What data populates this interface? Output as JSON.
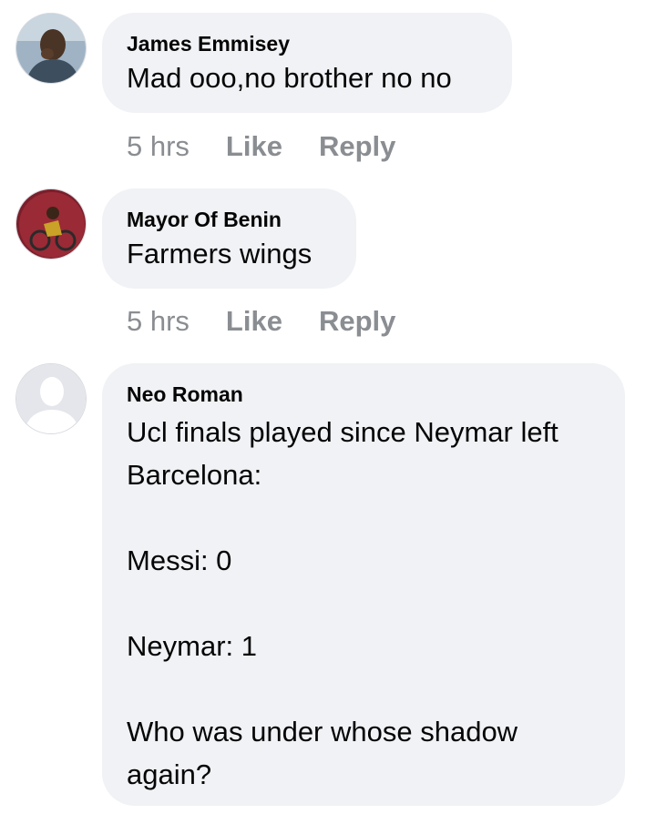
{
  "comments": [
    {
      "author": "James Emmisey",
      "text": "Mad ooo,no brother no no",
      "time": "5 hrs",
      "like_label": "Like",
      "reply_label": "Reply",
      "avatar": "photo-avatar"
    },
    {
      "author": "Mayor Of Benin",
      "text": "Farmers wings",
      "time": "5 hrs",
      "like_label": "Like",
      "reply_label": "Reply",
      "avatar": "photo-avatar"
    },
    {
      "author": "Neo Roman",
      "text": "Ucl finals played since Neymar left\nBarcelona:\n\nMessi: 0\n\nNeymar: 1\n\nWho was under whose shadow\nagain?",
      "avatar": "default-user-silhouette"
    }
  ],
  "colors": {
    "bubble": "#f0f2f5",
    "meta_text": "#8a8d91",
    "body_text": "#050505"
  }
}
